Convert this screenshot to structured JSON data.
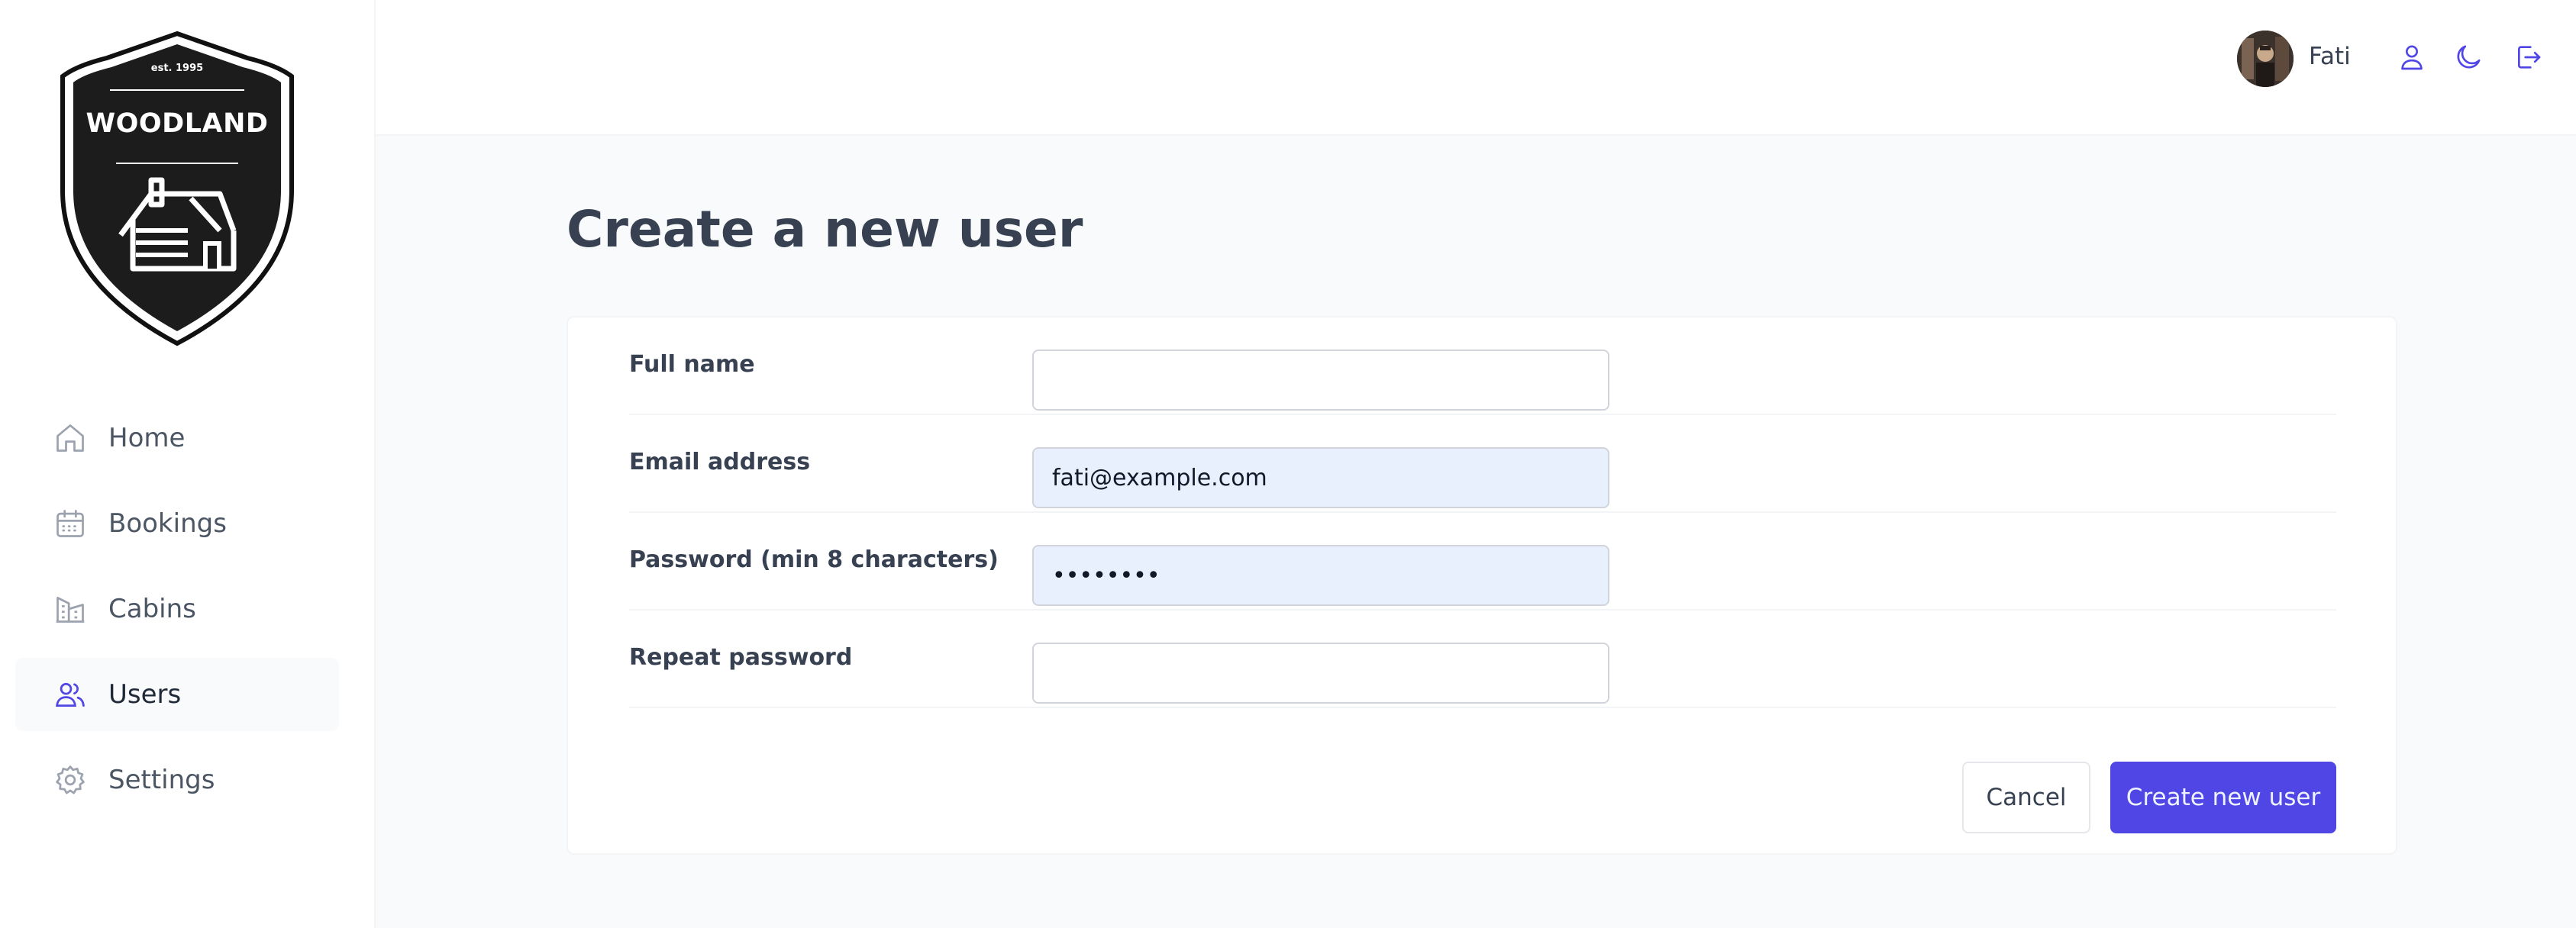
{
  "app": {
    "logo": {
      "est": "est. 1995",
      "name": "WOODLAND"
    },
    "accent_color": "#4f46e5"
  },
  "sidebar": {
    "items": [
      {
        "label": "Home",
        "icon": "home-icon",
        "active": false
      },
      {
        "label": "Bookings",
        "icon": "calendar-icon",
        "active": false
      },
      {
        "label": "Cabins",
        "icon": "building-icon",
        "active": false
      },
      {
        "label": "Users",
        "icon": "users-icon",
        "active": true
      },
      {
        "label": "Settings",
        "icon": "gear-icon",
        "active": false
      }
    ]
  },
  "header": {
    "username": "Fati",
    "icons": [
      "user-icon",
      "moon-icon",
      "logout-icon"
    ]
  },
  "main": {
    "title": "Create a new user",
    "form": {
      "fields": [
        {
          "label": "Full name",
          "value": "",
          "type": "text"
        },
        {
          "label": "Email address",
          "value": "fati@example.com",
          "type": "email"
        },
        {
          "label": "Password (min 8 characters)",
          "value": "abcd1234",
          "type": "password"
        },
        {
          "label": "Repeat password",
          "value": "",
          "type": "password"
        }
      ],
      "cancel_label": "Cancel",
      "submit_label": "Create new user"
    }
  }
}
